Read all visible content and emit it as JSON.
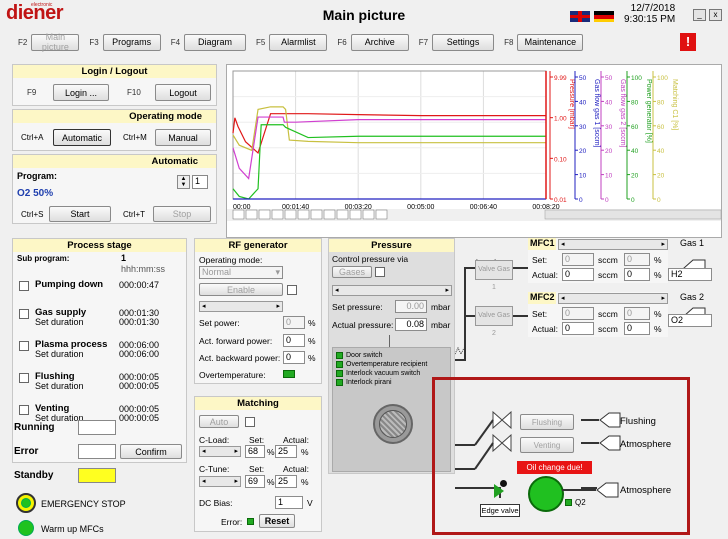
{
  "header": {
    "logo": "diener",
    "logo_sub": "electronic",
    "title": "Main picture",
    "date": "12/7/2018",
    "time": "9:30:15 PM",
    "min_glyph": "_",
    "close_glyph": "x"
  },
  "fkeys": [
    {
      "key": "F2",
      "label": "Main picture",
      "disabled": true
    },
    {
      "key": "F3",
      "label": "Programs"
    },
    {
      "key": "F4",
      "label": "Diagram"
    },
    {
      "key": "F5",
      "label": "Alarmlist"
    },
    {
      "key": "F6",
      "label": "Archive"
    },
    {
      "key": "F7",
      "label": "Settings"
    },
    {
      "key": "F8",
      "label": "Maintenance"
    }
  ],
  "alarm_glyph": "!",
  "login": {
    "title": "Login / Logout",
    "k1": "F9",
    "b1": "Login ...",
    "k2": "F10",
    "b2": "Logout"
  },
  "opmode": {
    "title": "Operating mode",
    "k1": "Ctrl+A",
    "b1": "Automatic",
    "k2": "Ctrl+M",
    "b2": "Manual"
  },
  "auto": {
    "title": "Automatic",
    "program_label": "Program:",
    "program_value": "1",
    "program_name": "O2 50%",
    "k1": "Ctrl+S",
    "b1": "Start",
    "k2": "Ctrl+T",
    "b2": "Stop"
  },
  "chart_data": {
    "type": "line",
    "xticks": [
      "00:00",
      "00:01:40",
      "00:03:20",
      "00:05:00",
      "00:06:40",
      "00:08:20"
    ],
    "axes": [
      {
        "label": "Pressure [mbar]",
        "color": "#e01818",
        "ticks": [
          "9.99",
          "1.00",
          "0.10",
          "0.01"
        ],
        "log": true
      },
      {
        "label": "Gas flow gas 1 [sccm]",
        "color": "#2020c0",
        "ticks": [
          "50",
          "40",
          "30",
          "20",
          "10",
          "0"
        ]
      },
      {
        "label": "Gas flow gas 2 [sccm]",
        "color": "#c040c0",
        "ticks": [
          "50",
          "40",
          "30",
          "20",
          "10",
          "0"
        ]
      },
      {
        "label": "Power generator [%]",
        "color": "#20a020",
        "ticks": [
          "100",
          "80",
          "60",
          "40",
          "20",
          "0"
        ]
      },
      {
        "label": "Matching C1 [%]",
        "color": "#c8c040",
        "ticks": [
          "100",
          "80",
          "60",
          "40",
          "20",
          "0"
        ]
      }
    ],
    "series": [
      {
        "color": "#e01818",
        "x": [
          0,
          3,
          8,
          20,
          40,
          60,
          80,
          120,
          200,
          300,
          500
        ],
        "y": [
          0.35,
          0.8,
          0.5,
          0.22,
          0.12,
          1.0,
          1.0,
          1.0,
          0.95,
          0.9,
          0.9
        ]
      },
      {
        "color": "#c8c040",
        "x": [
          0,
          10,
          30,
          40,
          60,
          80,
          84,
          90,
          120,
          200,
          300,
          500
        ],
        "y": [
          50,
          42,
          38,
          70,
          72,
          72,
          70,
          46,
          45,
          44,
          44,
          44
        ]
      },
      {
        "color": "#d040d0",
        "x": [
          0,
          10,
          25,
          40,
          60,
          80,
          82,
          100,
          200,
          300,
          500
        ],
        "y": [
          20,
          12,
          8,
          32,
          32,
          32,
          30,
          30,
          31,
          31,
          31
        ]
      },
      {
        "color": "#20c020",
        "x": [
          0,
          10,
          25,
          40,
          45,
          80,
          84,
          120,
          200,
          300,
          500
        ],
        "y": [
          8,
          2,
          0,
          8,
          58,
          58,
          56,
          48,
          49,
          49,
          49
        ]
      },
      {
        "color": "#2020c0",
        "x": [
          0,
          500
        ],
        "y": [
          0,
          0
        ]
      }
    ],
    "cursor_x": 500
  },
  "process": {
    "title": "Process stage",
    "sub_label": "Sub program:",
    "sub_value": "1",
    "format": "hhh:mm:ss",
    "stages": [
      {
        "name": "Pumping down",
        "time": "000:00:47"
      },
      {
        "name": "Gas supply",
        "sub": "Set duration",
        "time": "000:01:30",
        "time2": "000:01:30"
      },
      {
        "name": "Plasma process",
        "sub": "Set duration",
        "time": "000:06:00",
        "time2": "000:06:00"
      },
      {
        "name": "Flushing",
        "sub": "Set duration",
        "time": "000:00:05",
        "time2": "000:00:05"
      },
      {
        "name": "Venting",
        "sub": "Set duration",
        "time": "000:00:05",
        "time2": "000:00:05"
      }
    ],
    "running": "Running",
    "error": "Error",
    "confirm": "Confirm",
    "standby": "Standby",
    "estop": "EMERGENCY STOP",
    "warmup": "Warm up MFCs"
  },
  "rf": {
    "title": "RF generator",
    "mode_label": "Operating mode:",
    "mode_value": "Normal",
    "enable": "Enable",
    "setpower": "Set power:",
    "setpower_v": "0",
    "fwd": "Act. forward power:",
    "fwd_v": "0",
    "bwd": "Act. backward power:",
    "bwd_v": "0",
    "overtemp": "Overtemperature:",
    "unit": "%"
  },
  "matching": {
    "title": "Matching",
    "auto": "Auto",
    "cload": "C-Load:",
    "ctune": "C-Tune:",
    "set": "Set:",
    "actual": "Actual:",
    "cload_set": "68",
    "cload_act": "25",
    "ctune_set": "69",
    "ctune_act": "25",
    "unit": "%",
    "dcbias": "DC Bias:",
    "dcbias_v": "1",
    "dcbias_unit": "V",
    "error": "Error:",
    "reset": "Reset"
  },
  "pressure": {
    "title": "Pressure",
    "ctrl": "Control pressure via",
    "gases": "Gases",
    "set_label": "Set pressure:",
    "set_v": "0.00",
    "act_label": "Actual pressure:",
    "act_v": "0.08",
    "unit": "mbar",
    "interlocks": [
      "Door switch",
      "Overtemperature recipient",
      "Interlock vacuum switch",
      "Interlock pirani"
    ]
  },
  "mfc1": {
    "title": "MFC1",
    "set": "Set:",
    "set_v": "0",
    "act": "Actual:",
    "act_v": "0",
    "unit": "sccm",
    "pct": "0",
    "pct_unit": "%",
    "gas": "H2",
    "valve": "Valve Gas 1",
    "gas_label": "Gas 1"
  },
  "mfc2": {
    "title": "MFC2",
    "set": "Set:",
    "set_v": "0",
    "act": "Actual:",
    "act_v": "0",
    "unit": "sccm",
    "pct": "0",
    "pct_unit": "%",
    "gas": "O2",
    "valve": "Valve Gas 2",
    "gas_label": "Gas 2"
  },
  "pump": {
    "flushing": "Flushing",
    "venting": "Venting",
    "flushing_out": "Flushing",
    "atmos1": "Atmosphere",
    "atmos2": "Atmosphere",
    "oil": "Oil change due!",
    "edge": "Edge valve",
    "q2": "Q2"
  }
}
